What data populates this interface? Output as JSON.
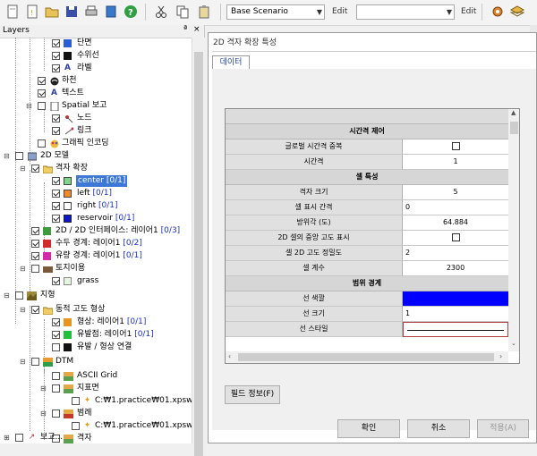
{
  "toolbar": {
    "scenario_value": "Base Scenario",
    "edit1_label": "Edit",
    "scenario2_value": "",
    "edit2_label": "Edit"
  },
  "layers": {
    "title": "Layers",
    "pin": "ª",
    "close": "×",
    "rows": [
      {
        "label": "단면",
        "count": ""
      },
      {
        "label": "수위선",
        "count": ""
      },
      {
        "label": "라벨",
        "count": ""
      },
      {
        "label": "하천",
        "count": ""
      },
      {
        "label": "텍스트",
        "count": ""
      },
      {
        "label": "Spatial 보고",
        "count": ""
      },
      {
        "label": "노드",
        "count": ""
      },
      {
        "label": "링크",
        "count": ""
      },
      {
        "label": "그래픽 인코딩",
        "count": ""
      },
      {
        "label": "2D 모델",
        "count": ""
      },
      {
        "label": "격자 확장",
        "count": ""
      },
      {
        "label": "center",
        "count": "[0/1]"
      },
      {
        "label": "left",
        "count": "[0/1]"
      },
      {
        "label": "right",
        "count": "[0/1]"
      },
      {
        "label": "reservoir",
        "count": "[0/1]"
      },
      {
        "label": "2D / 2D 인터페이스: 레이어1",
        "count": "[0/3]"
      },
      {
        "label": "수두 경계: 레이어1",
        "count": "[0/2]"
      },
      {
        "label": "유량 경계: 레이어1",
        "count": "[0/1]"
      },
      {
        "label": "토지이용",
        "count": ""
      },
      {
        "label": "grass",
        "count": ""
      },
      {
        "label": "지형",
        "count": ""
      },
      {
        "label": "동적 고도 형상",
        "count": ""
      },
      {
        "label": "형상: 레이어1",
        "count": "[0/1]"
      },
      {
        "label": "유발점: 레이어1",
        "count": "[0/1]"
      },
      {
        "label": "유발 / 형상 연결",
        "count": ""
      },
      {
        "label": "DTM",
        "count": ""
      },
      {
        "label": "ASCII Grid",
        "count": ""
      },
      {
        "label": "지표면",
        "count": ""
      },
      {
        "label": "C:₩1.practice₩01.xpswmm₩",
        "count": ""
      },
      {
        "label": "범례",
        "count": ""
      },
      {
        "label": "C:₩1.practice₩01.xpswmm₩",
        "count": ""
      },
      {
        "label": "격자",
        "count": ""
      },
      {
        "label": "보고...",
        "count": ""
      }
    ]
  },
  "dialog": {
    "title": "2D 격자 확장 특성",
    "tab_label": "데이터",
    "grid": {
      "rows": [
        {
          "kind": "blank"
        },
        {
          "kind": "section",
          "label": "시간격 제어"
        },
        {
          "kind": "prop",
          "label": "글로벌 시간격 중복",
          "value": "",
          "checkbox": true
        },
        {
          "kind": "prop",
          "label": "시간격",
          "value": "1"
        },
        {
          "kind": "section",
          "label": "셀 특성"
        },
        {
          "kind": "prop",
          "label": "격자 크기",
          "value": "5"
        },
        {
          "kind": "prop",
          "label": "셀 표시 간격",
          "value": "0",
          "align": "left"
        },
        {
          "kind": "prop",
          "label": "방위각 (도)",
          "value": "64.884"
        },
        {
          "kind": "prop",
          "label": "2D 셀의 중앙 고도 표시",
          "value": "",
          "checkbox": true
        },
        {
          "kind": "prop",
          "label": "셀 2D 고도 정밀도",
          "value": "2",
          "align": "left"
        },
        {
          "kind": "prop",
          "label": "셀 계수",
          "value": "2300"
        },
        {
          "kind": "section",
          "label": "범위 경계"
        },
        {
          "kind": "prop",
          "label": "선 색깔",
          "value": "",
          "color": "#0000ff"
        },
        {
          "kind": "prop",
          "label": "선 크기",
          "value": "1",
          "align": "left"
        },
        {
          "kind": "prop",
          "label": "선 스타일",
          "value": "",
          "style": true
        }
      ]
    },
    "field_info_label": "필드 정보(F)",
    "ok_label": "확인",
    "cancel_label": "취소",
    "apply_label": "적용(A)"
  }
}
